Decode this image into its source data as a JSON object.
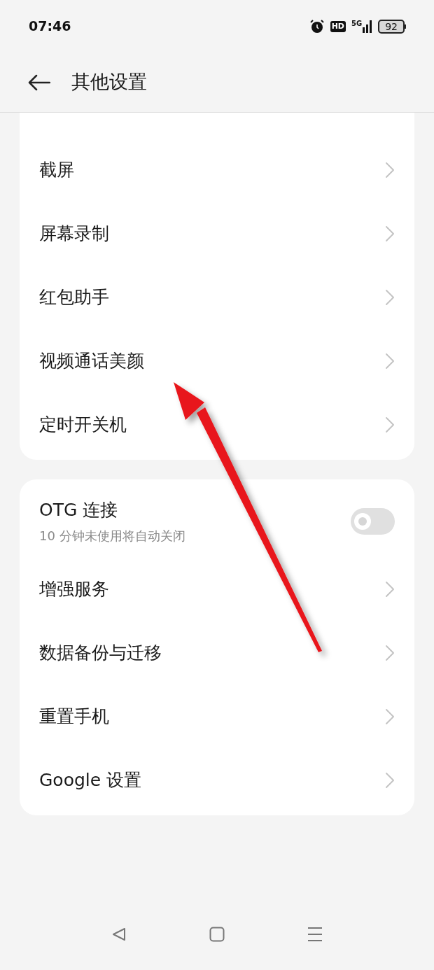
{
  "status_bar": {
    "time": "07:46",
    "hd": "HD",
    "network": "5G",
    "battery": "92"
  },
  "header": {
    "title": "其他设置"
  },
  "groups": [
    {
      "items": [
        {
          "kind": "link",
          "label": "截屏"
        },
        {
          "kind": "link",
          "label": "屏幕录制"
        },
        {
          "kind": "link",
          "label": "红包助手"
        },
        {
          "kind": "link",
          "label": "视频通话美颜"
        },
        {
          "kind": "link",
          "label": "定时开关机"
        }
      ]
    },
    {
      "items": [
        {
          "kind": "toggle",
          "label": "OTG 连接",
          "subtitle": "10 分钟未使用将自动关闭",
          "on": false
        },
        {
          "kind": "link",
          "label": "增强服务"
        },
        {
          "kind": "link",
          "label": "数据备份与迁移"
        },
        {
          "kind": "link",
          "label": "重置手机"
        },
        {
          "kind": "link",
          "label": "Google 设置"
        }
      ]
    }
  ]
}
